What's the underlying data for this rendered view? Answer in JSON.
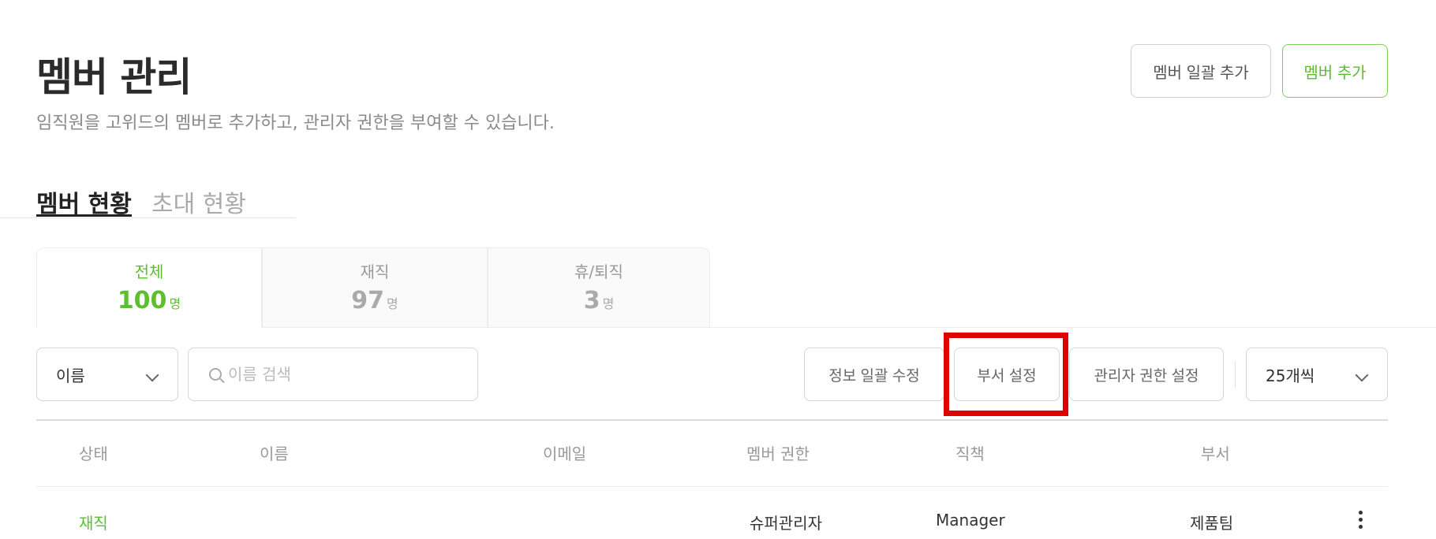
{
  "header": {
    "title": "멤버 관리",
    "description": "임직원을 고위드의 멤버로 추가하고, 관리자 권한을 부여할 수 있습니다.",
    "bulk_add_label": "멤버 일괄 추가",
    "add_label": "멤버 추가"
  },
  "tabs": [
    {
      "label": "멤버 현황",
      "active": true
    },
    {
      "label": "초대 현황",
      "active": false
    }
  ],
  "stats": [
    {
      "label": "전체",
      "value": "100",
      "unit": "명",
      "active": true
    },
    {
      "label": "재직",
      "value": "97",
      "unit": "명",
      "active": false
    },
    {
      "label": "휴/퇴직",
      "value": "3",
      "unit": "명",
      "active": false
    }
  ],
  "toolbar": {
    "search_field": "이름",
    "search_placeholder": "이름 검색",
    "bulk_edit_label": "정보 일괄 수정",
    "dept_label": "부서 설정",
    "admin_label": "관리자 권한 설정",
    "page_size": "25개씩"
  },
  "table": {
    "columns": [
      "상태",
      "이름",
      "이메일",
      "멤버 권한",
      "직책",
      "부서"
    ],
    "rows": [
      {
        "status": "재직",
        "name": "",
        "email": "",
        "role": "슈퍼관리자",
        "position": "Manager",
        "department": "제품팀"
      }
    ]
  },
  "colors": {
    "accent": "#5bbf2e",
    "highlight": "#e00000"
  }
}
